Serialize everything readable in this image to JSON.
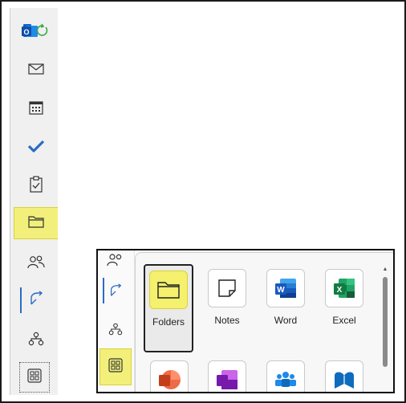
{
  "rail": {
    "items": [
      {
        "name": "outlook-app-icon",
        "icon": "outlook-icon"
      },
      {
        "name": "mail",
        "icon": "mail-icon"
      },
      {
        "name": "calendar",
        "icon": "calendar-icon"
      },
      {
        "name": "to-do",
        "icon": "checkmark-icon"
      },
      {
        "name": "tasks",
        "icon": "clipboard-check-icon"
      },
      {
        "name": "folders",
        "icon": "folder-icon",
        "highlighted": true
      },
      {
        "name": "people",
        "icon": "people-icon"
      },
      {
        "name": "viva-engage",
        "icon": "arrow-icon"
      },
      {
        "name": "org-explorer",
        "icon": "org-chart-icon"
      },
      {
        "name": "more-apps",
        "icon": "grid-icon"
      }
    ]
  },
  "panel": {
    "apps": [
      {
        "label": "Folders",
        "icon": "folder-icon",
        "selected": true
      },
      {
        "label": "Notes",
        "icon": "note-icon"
      },
      {
        "label": "Word",
        "icon": "word-icon"
      },
      {
        "label": "Excel",
        "icon": "excel-icon"
      }
    ],
    "colors": {
      "highlight": "#f2f07a",
      "word_blue": "#185abd",
      "excel_green": "#107c41",
      "accent": "#2b6cc4",
      "powerpoint_orange": "#d24726",
      "onenote_purple": "#7719aa"
    }
  }
}
